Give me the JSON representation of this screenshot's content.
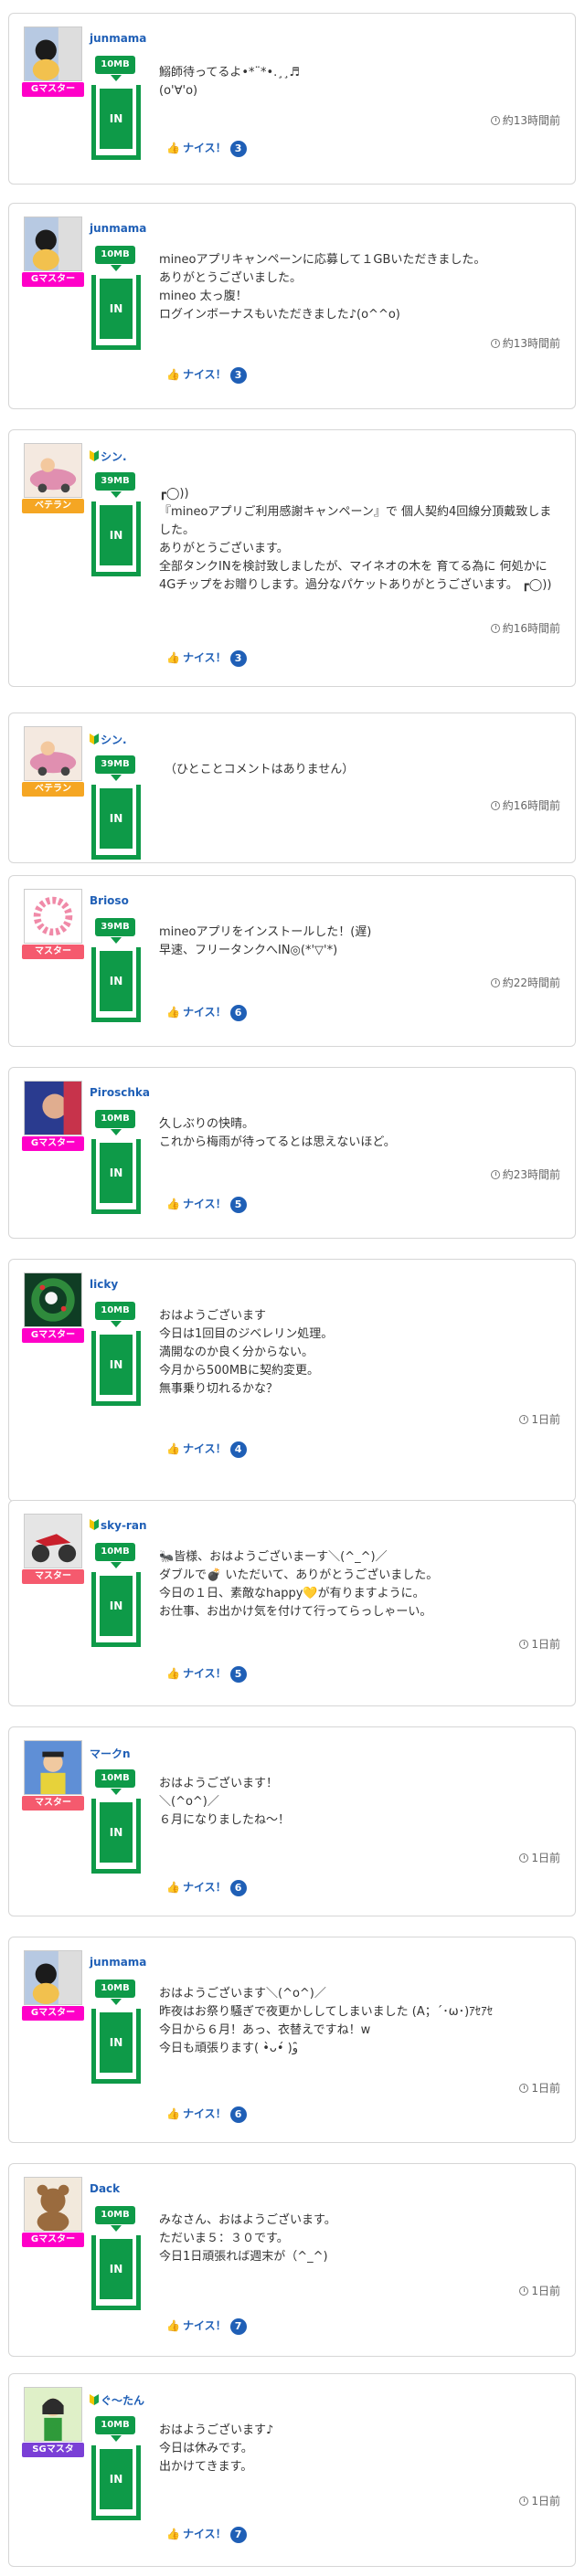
{
  "nice_label": "ナイス！",
  "tank_label": "IN",
  "posts": [
    {
      "user": "junmama",
      "rank": "Gマスター",
      "badge": "10MB",
      "message": "鰯師待ってるよ•*¨*•.¸¸♬\n(o'∀'o)",
      "time": "約13時間前",
      "nice": "3"
    },
    {
      "user": "junmama",
      "rank": "Gマスター",
      "badge": "10MB",
      "message": "mineoアプリキャンペーンに応募して１GBいただきました。\nありがとうございました。\nmineo 太っ腹！\nログインボーナスもいただきました♪(o^^o)",
      "time": "約13時間前",
      "nice": "3"
    },
    {
      "user": "シン.",
      "rank": "ベテラン",
      "badge": "39MB",
      "message": "┏◯))\n『mineoアプリご利用感謝キャンペーン』で 個人契約4回線分頂戴致しました。\nありがとうございます。\n全部タンクINを検討致しましたが、マイネオの木を 育てる為に 何処かに4Gチップをお贈りします。過分なパケットありがとうございます。 ┏◯))",
      "time": "約16時間前",
      "nice": "3"
    },
    {
      "user": "シン.",
      "rank": "ベテラン",
      "badge": "39MB",
      "message": "（ひとことコメントはありません）",
      "time": "約16時間前",
      "nice": ""
    },
    {
      "user": "Brioso",
      "rank": "マスター",
      "badge": "39MB",
      "message": "mineoアプリをインストールした！(遅)\n早速、フリータンクへIN◎(*'▽'*)",
      "time": "約22時間前",
      "nice": "6"
    },
    {
      "user": "Piroschka",
      "rank": "Gマスター",
      "badge": "10MB",
      "message": "久しぶりの快晴。\nこれから梅雨が待ってるとは思えないほど。",
      "time": "約23時間前",
      "nice": "5"
    },
    {
      "user": "licky",
      "rank": "Gマスター",
      "badge": "10MB",
      "message": "おはようございます\n今日は1回目のジベレリン処理。\n満開なのか良く分からない。\n今月から500MBに契約変更。\n無事乗り切れるかな？",
      "time": "1日前",
      "nice": "4"
    },
    {
      "user": "sky-ran",
      "rank": "マスター",
      "badge": "10MB",
      "message": "🐜皆様、おはようございまーす＼(^_^)／\nダブルで💣 いただいて、ありがとうございました。\n今日の１日、素敵なhappy💛が有りますように。\nお仕事、お出かけ気を付けて行ってらっしゃーい。",
      "time": "1日前",
      "nice": "5"
    },
    {
      "user": "マークn",
      "rank": "マスター",
      "badge": "10MB",
      "message": "おはようございます！\n＼(^o^)／\n６月になりましたね〜！",
      "time": "1日前",
      "nice": "6"
    },
    {
      "user": "junmama",
      "rank": "Gマスター",
      "badge": "10MB",
      "message": "おはようございます＼(^o^)／\n昨夜はお祭り騒ぎで夜更かししてしまいました (A；´･ω･)ｱｾｱｾ\n今日から６月！あっ、衣替えですね！w\n今日も頑張ります( •̀ᴗ•́ )و ̑̑",
      "time": "1日前",
      "nice": "6"
    },
    {
      "user": "Dack",
      "rank": "Gマスター",
      "badge": "10MB",
      "message": "みなさん、おはようございます。\nただいま５：３０です。\n今日1日頑張れば週末が（^_^)",
      "time": "1日前",
      "nice": "7"
    },
    {
      "user": "ぐ〜たん",
      "rank": "SGマスタ",
      "badge": "10MB",
      "message": "おはようございます♪\n今日は休みです。\n出かけてきます。",
      "time": "1日前",
      "nice": "7"
    }
  ]
}
